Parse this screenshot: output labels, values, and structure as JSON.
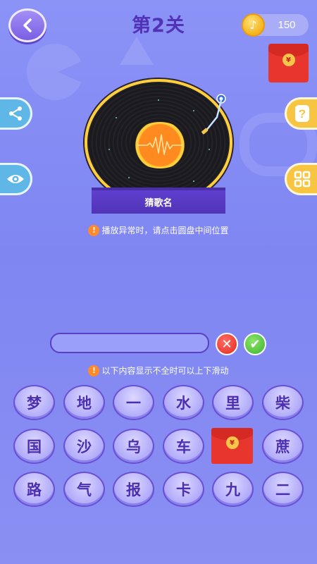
{
  "header": {
    "level_title": "第2关",
    "coins": "150",
    "coin_glyph": "♪"
  },
  "record": {
    "banner": "猜歌名"
  },
  "hints": {
    "playback": "播放异常时，请点击圆盘中间位置",
    "scroll": "以下内容显示不全时可以上下滑动"
  },
  "answer": {
    "value": "",
    "clear_glyph": "✕",
    "confirm_glyph": "✔"
  },
  "redpacket_symbol": "¥",
  "characters": [
    [
      "梦",
      "地",
      "一",
      "水",
      "里",
      "柴"
    ],
    [
      "国",
      "沙",
      "乌",
      "车",
      "",
      "蔗"
    ],
    [
      "路",
      "气",
      "报",
      "卡",
      "九",
      "二"
    ]
  ],
  "colors": {
    "accent": "#5233b8",
    "share": "#5fb7e8",
    "help": "#f8c542"
  }
}
